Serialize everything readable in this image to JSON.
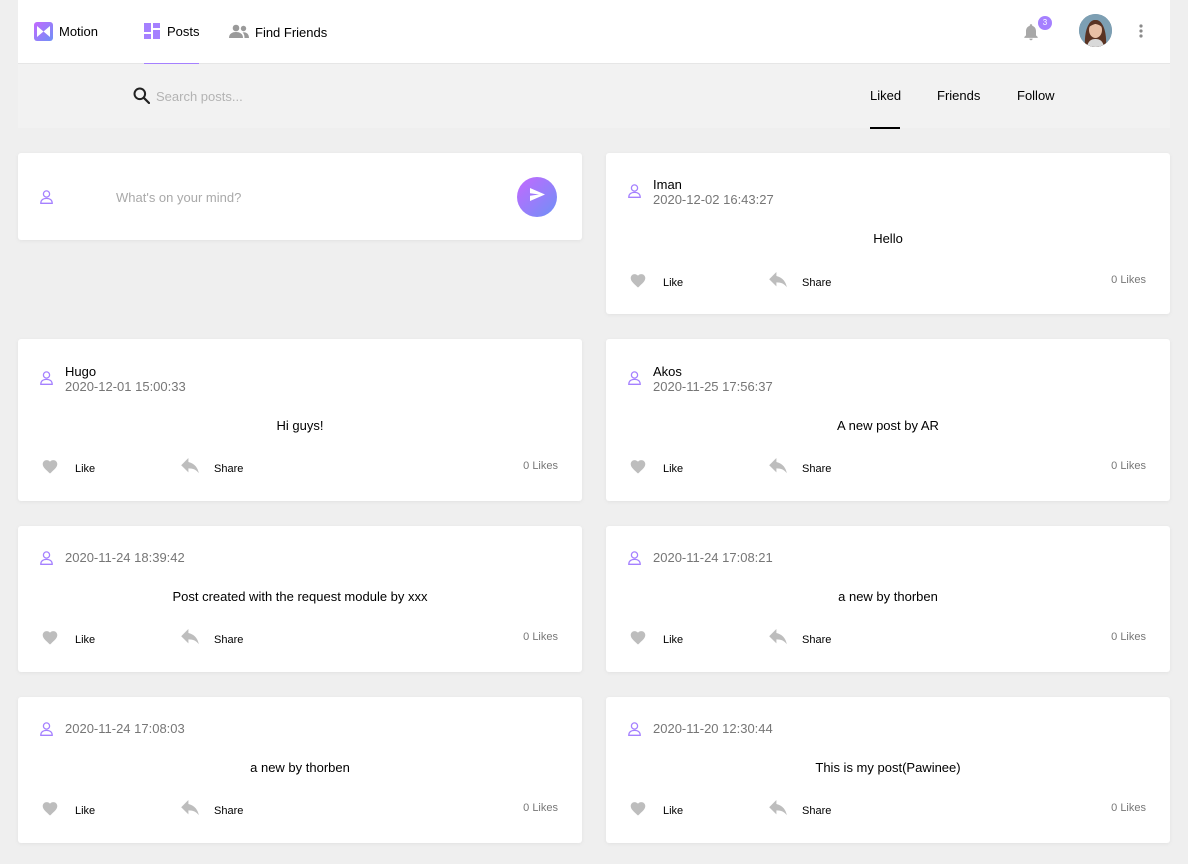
{
  "nav": {
    "brand": "Motion",
    "posts_label": "Posts",
    "find_friends_label": "Find Friends",
    "notification_count": "3",
    "accent": "#a580ff"
  },
  "subnav": {
    "search_placeholder": "Search posts...",
    "tabs": [
      {
        "label": "Liked",
        "active": true
      },
      {
        "label": "Friends",
        "active": false
      },
      {
        "label": "Follow",
        "active": false
      }
    ]
  },
  "composer": {
    "placeholder": "What's on your mind?"
  },
  "post_actions": {
    "like_label": "Like",
    "share_label": "Share"
  },
  "posts": [
    {
      "author": "Iman",
      "timestamp": "2020-12-02 16:43:27",
      "content": "Hello",
      "likes": "0 Likes"
    },
    {
      "author": "Hugo",
      "timestamp": "2020-12-01 15:00:33",
      "content": "Hi guys!",
      "likes": "0 Likes"
    },
    {
      "author": "Akos",
      "timestamp": "2020-11-25 17:56:37",
      "content": "A new post by AR",
      "likes": "0 Likes"
    },
    {
      "author": "",
      "timestamp": "2020-11-24 18:39:42",
      "content": "Post created with the request module by xxx",
      "likes": "0 Likes"
    },
    {
      "author": "",
      "timestamp": "2020-11-24 17:08:21",
      "content": "a new by thorben",
      "likes": "0 Likes"
    },
    {
      "author": "",
      "timestamp": "2020-11-24 17:08:03",
      "content": "a new by thorben",
      "likes": "0 Likes"
    },
    {
      "author": "",
      "timestamp": "2020-11-20 12:30:44",
      "content": "This is my post(Pawinee)",
      "likes": "0 Likes"
    }
  ]
}
